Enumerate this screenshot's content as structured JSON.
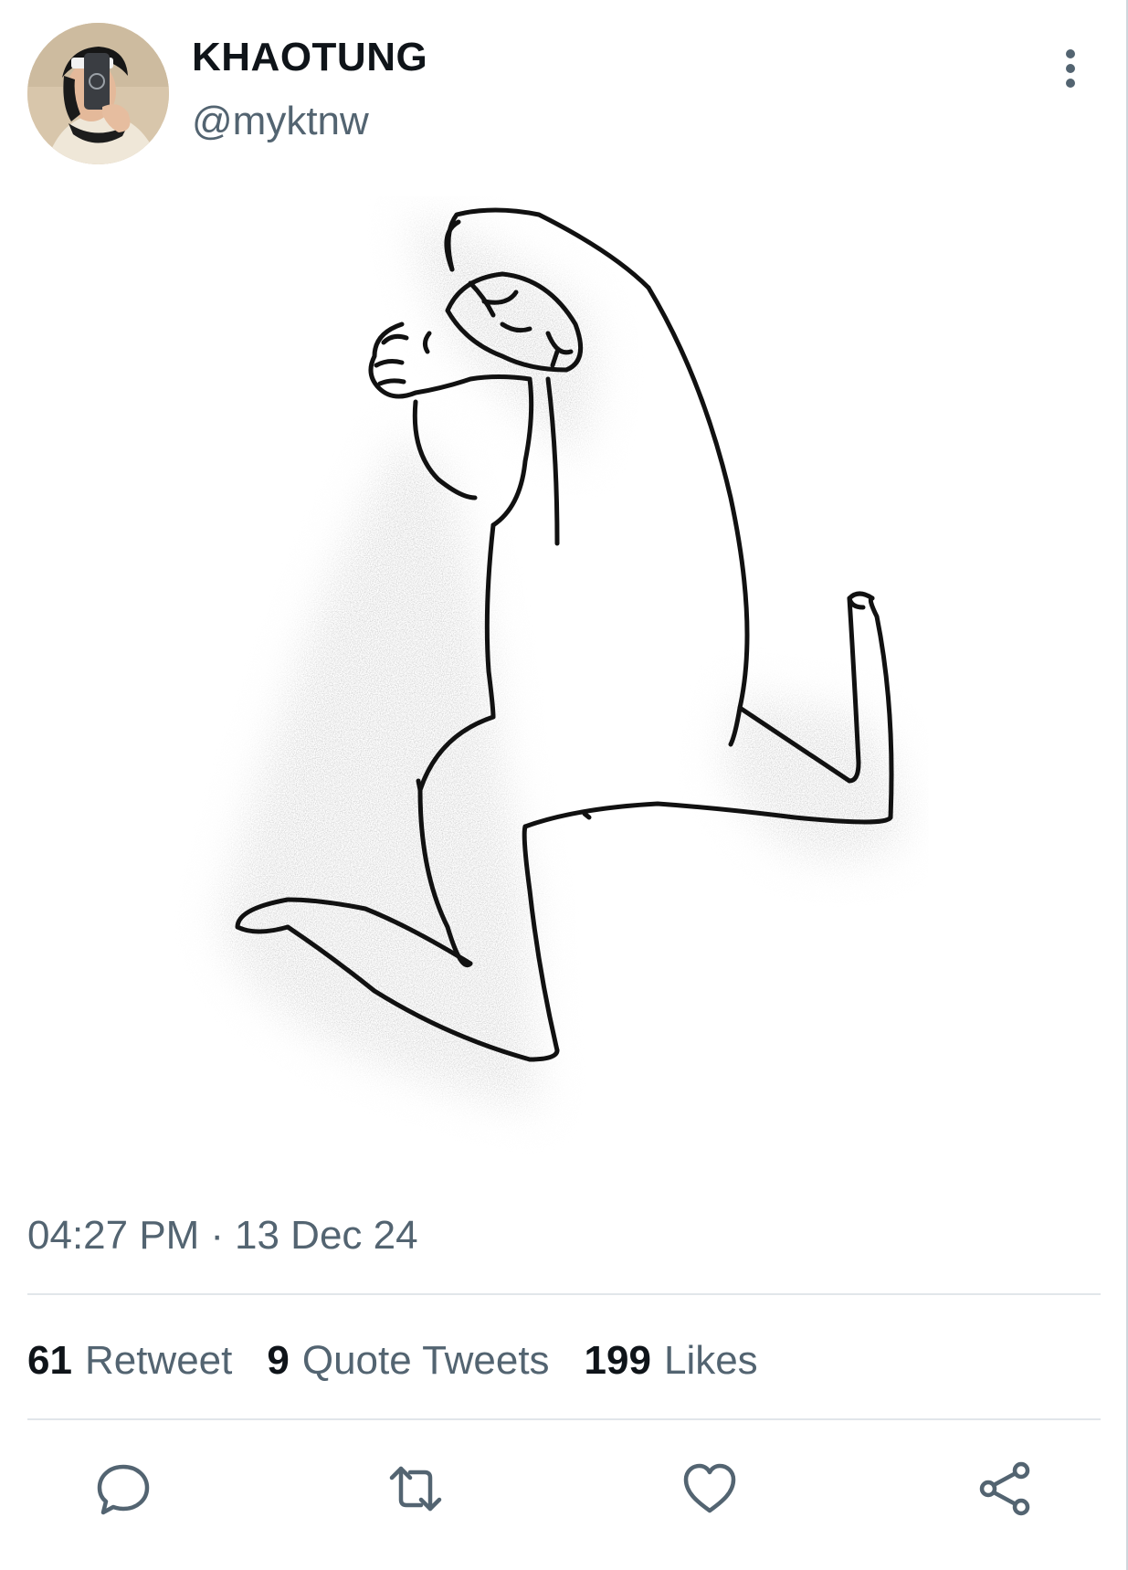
{
  "tweet": {
    "author": {
      "display_name": "KHAOTUNG",
      "handle": "@myktnw"
    },
    "timestamp": {
      "time": "04:27 PM",
      "separator": "·",
      "date": "13 Dec 24"
    },
    "stats": [
      {
        "count": "61",
        "label": "Retweet"
      },
      {
        "count": "9",
        "label": "Quote Tweets"
      },
      {
        "count": "199",
        "label": "Likes"
      }
    ]
  },
  "icons": {
    "more": "more-vertical-icon",
    "reply": "reply-icon",
    "retweet": "retweet-icon",
    "like": "heart-icon",
    "share": "share-icon"
  },
  "colors": {
    "primary_text": "#0f1419",
    "secondary_text": "#536471",
    "divider": "#e1e6ea"
  }
}
